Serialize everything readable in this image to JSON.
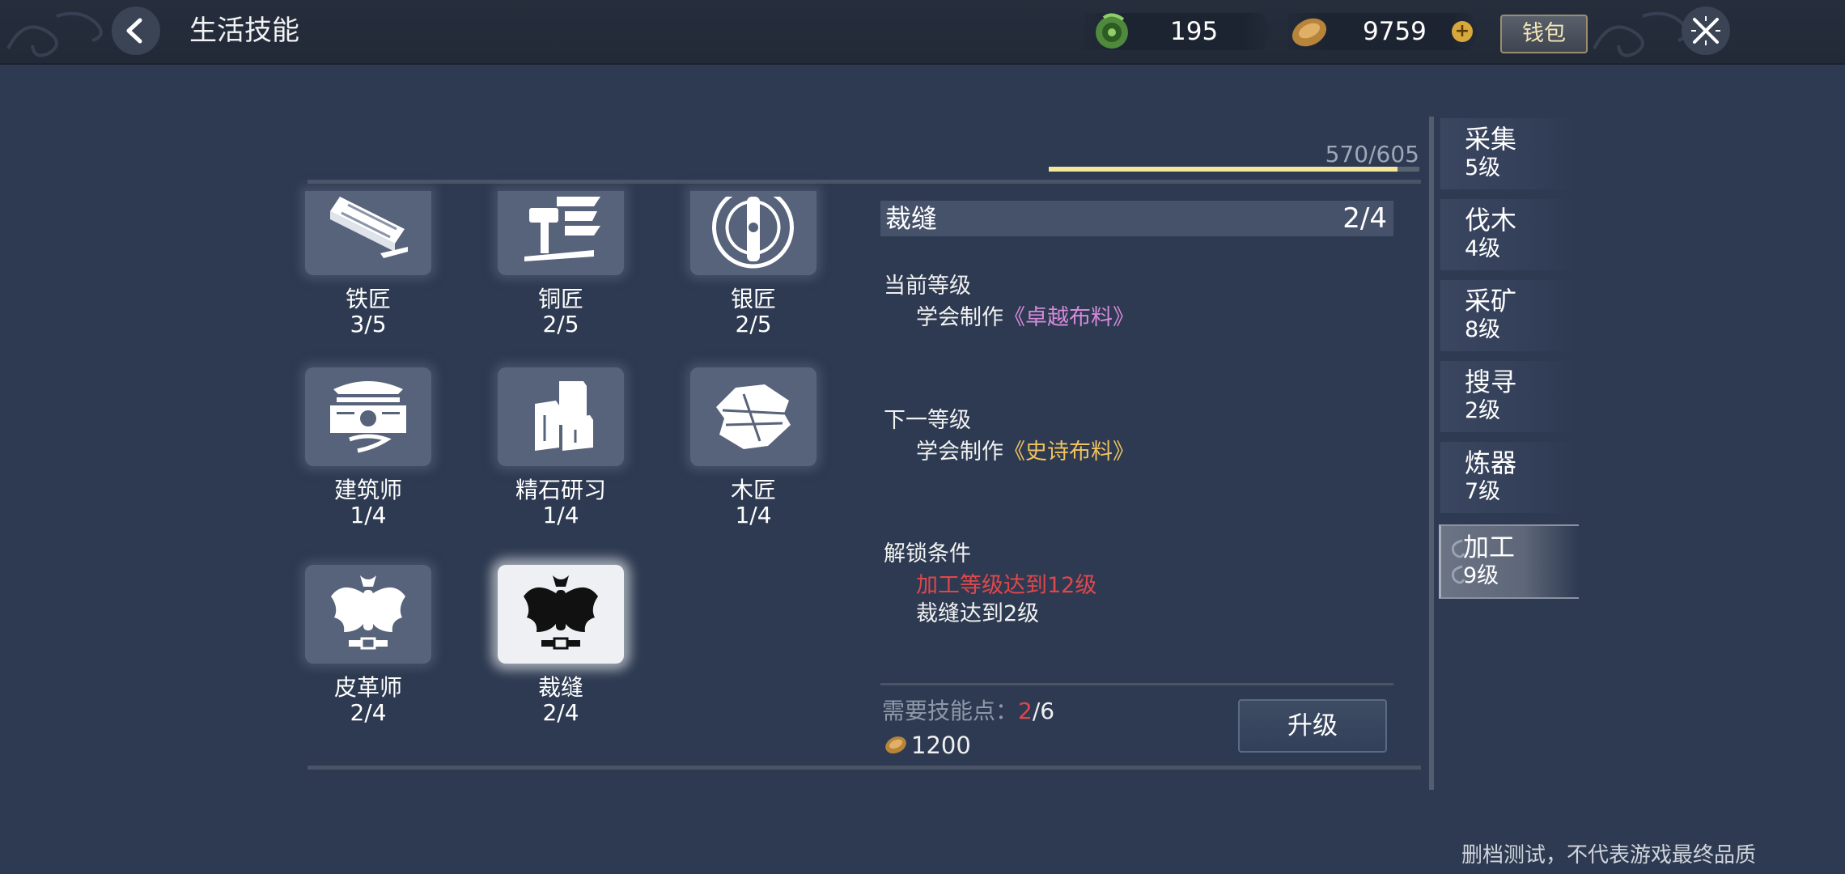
{
  "header": {
    "title": "生活技能",
    "currency_green_value": "195",
    "currency_gold_value": "9759",
    "wallet_label": "钱包",
    "icons": [
      "back-arrow-icon",
      "jade-coin-icon",
      "gold-ingot-icon",
      "plus-icon",
      "close-icon"
    ]
  },
  "progress": {
    "text": "570/605",
    "fraction": 0.942
  },
  "skills": [
    {
      "name": "铁匠",
      "level": "3/5",
      "icon": "iron-plank-icon"
    },
    {
      "name": "铜匠",
      "level": "2/5",
      "icon": "hammer-icon"
    },
    {
      "name": "银匠",
      "level": "2/5",
      "icon": "silver-emblem-icon"
    },
    {
      "name": "建筑师",
      "level": "1/4",
      "icon": "building-icon"
    },
    {
      "name": "精石研习",
      "level": "1/4",
      "icon": "stone-blocks-icon"
    },
    {
      "name": "木匠",
      "level": "1/4",
      "icon": "wood-log-icon"
    },
    {
      "name": "皮革师",
      "level": "2/4",
      "icon": "leather-wings-icon"
    },
    {
      "name": "裁缝",
      "level": "2/4",
      "icon": "tailor-wings-icon"
    }
  ],
  "detail": {
    "name": "裁缝",
    "progress": "2/4",
    "current_level_label": "当前等级",
    "current_prefix": "学会制作",
    "current_item": "《卓越布料》",
    "next_level_label": "下一等级",
    "next_prefix": "学会制作",
    "next_item": "《史诗布料》",
    "unlock_label": "解锁条件",
    "unlock_req_1": "加工等级达到12级",
    "unlock_req_2": "裁缝达到2级",
    "cost_label": "需要技能点：",
    "cost_have": "2",
    "cost_total": "/6",
    "gold_cost": "1200",
    "upgrade_label": "升级"
  },
  "tabs": [
    {
      "title": "采集",
      "level": "5级"
    },
    {
      "title": "伐木",
      "level": "4级"
    },
    {
      "title": "采矿",
      "level": "8级"
    },
    {
      "title": "搜寻",
      "level": "2级"
    },
    {
      "title": "炼器",
      "level": "7级"
    },
    {
      "title": "加工",
      "level": "9级",
      "active": true
    }
  ],
  "footer_note": "删档测试，不代表游戏最终品质",
  "colors": {
    "background": "#2d3a51",
    "progress_fill": "#f4e79a",
    "purple_item": "#d58ad8",
    "gold_item": "#efc25f",
    "unmet_requirement": "#e0474b"
  }
}
